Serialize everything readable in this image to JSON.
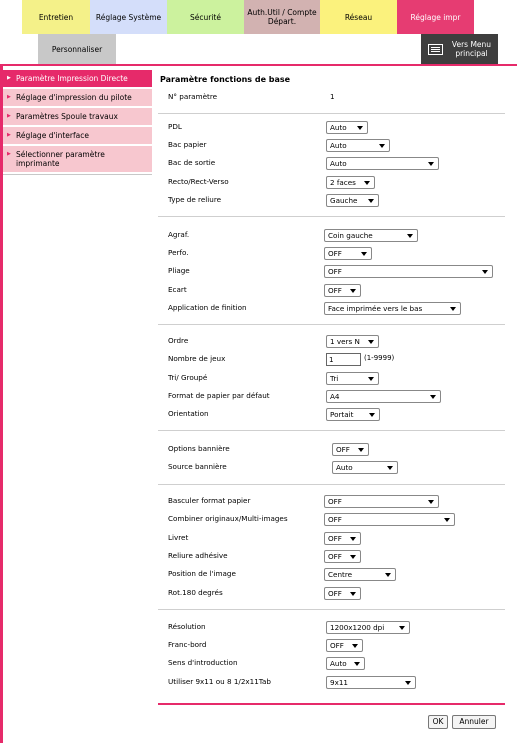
{
  "tabs": [
    {
      "label": "Entretien"
    },
    {
      "label": "Réglage Système"
    },
    {
      "label": "Sécurité"
    },
    {
      "label": "Auth.Util / Compte Départ."
    },
    {
      "label": "Réseau"
    },
    {
      "label": "Réglage impr"
    }
  ],
  "subtab": {
    "label": "Personnaliser"
  },
  "menu_button": {
    "label": "Vers Menu principal",
    "icon": "menu-icon"
  },
  "sidebar": {
    "items": [
      {
        "label": "Paramètre Impression Directe",
        "active": true
      },
      {
        "label": "Réglage d'impression du pilote"
      },
      {
        "label": "Paramètres Spoule travaux"
      },
      {
        "label": "Réglage d'interface"
      },
      {
        "label": "Sélectionner paramètre imprimante"
      }
    ]
  },
  "main": {
    "heading": "Paramètre fonctions de base",
    "param_label": "N° paramètre",
    "param_value": "1",
    "pdl": {
      "label": "PDL",
      "value": "Auto"
    },
    "bac_papier": {
      "label": "Bac papier",
      "value": "Auto"
    },
    "bac_sortie": {
      "label": "Bac de sortie",
      "value": "Auto"
    },
    "recto_verso": {
      "label": "Recto/Rect-Verso",
      "value": "2 faces"
    },
    "reliure": {
      "label": "Type de reliure",
      "value": "Gauche"
    },
    "agraf": {
      "label": "Agraf.",
      "value": "Coin gauche"
    },
    "perfo": {
      "label": "Perfo.",
      "value": "OFF"
    },
    "pliage": {
      "label": "Pliage",
      "value": "OFF"
    },
    "ecart": {
      "label": "Ecart",
      "value": "OFF"
    },
    "finition": {
      "label": "Application de finition",
      "value": "Face imprimée vers le bas"
    },
    "ordre": {
      "label": "Ordre",
      "value": "1 vers N"
    },
    "jeux": {
      "label": "Nombre de jeux",
      "value": "1",
      "range": "(1-9999)"
    },
    "tri": {
      "label": "Tri/ Groupé",
      "value": "Tri"
    },
    "format": {
      "label": "Format de papier par défaut",
      "value": "A4"
    },
    "orientation": {
      "label": "Orientation",
      "value": "Portait"
    },
    "banniere_options": {
      "label": "Options bannière",
      "value": "OFF"
    },
    "banniere_source": {
      "label": "Source bannière",
      "value": "Auto"
    },
    "basculer": {
      "label": "Basculer format papier",
      "value": "OFF"
    },
    "combiner": {
      "label": "Combiner originaux/Multi-images",
      "value": "OFF"
    },
    "livret": {
      "label": "Livret",
      "value": "OFF"
    },
    "reliure_adhesive": {
      "label": "Reliure adhésive",
      "value": "OFF"
    },
    "position_image": {
      "label": "Position de l'image",
      "value": "Centre"
    },
    "rotation": {
      "label": "Rot.180 degrés",
      "value": "OFF"
    },
    "resolution": {
      "label": "Résolution",
      "value": "1200x1200 dpi"
    },
    "franc_bord": {
      "label": "Franc-bord",
      "value": "OFF"
    },
    "sens": {
      "label": "Sens d'introduction",
      "value": "Auto"
    },
    "utiliser": {
      "label": "Utiliser 9x11 ou 8 1/2x11Tab",
      "value": "9x11"
    }
  },
  "buttons": {
    "ok": "OK",
    "cancel": "Annuler"
  },
  "colors": {
    "accent": "#e62a6a",
    "sidebar_bg": "#f7c7cf"
  }
}
